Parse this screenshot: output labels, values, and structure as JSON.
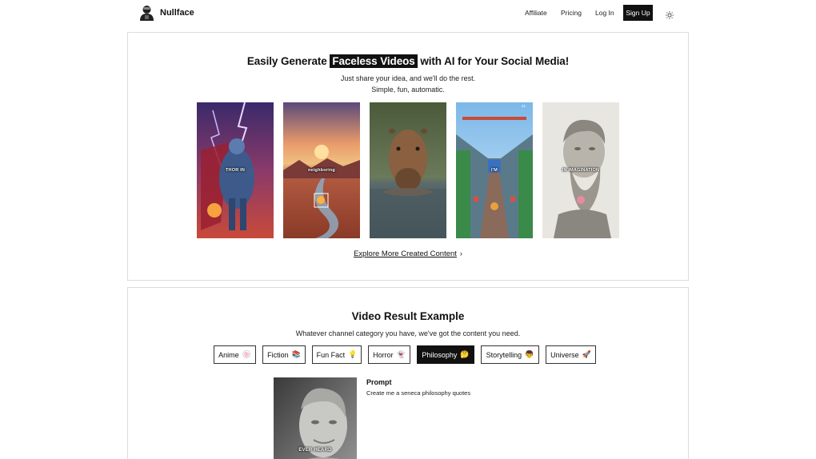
{
  "nav": {
    "brand": "Nullface",
    "links": [
      "Affiliate",
      "Pricing",
      "Log In"
    ],
    "signup": "Sign Up",
    "theme_icon": "sun-icon"
  },
  "hero": {
    "title_before": "Easily Generate",
    "title_highlight": "Faceless Videos",
    "title_after": "with AI for Your Social Media!",
    "subtitle_line1": "Just share your idea, and we'll do the rest.",
    "subtitle_line2": "Simple, fun, automatic.",
    "thumbnails": [
      {
        "caption": "THOR IN",
        "subject": "armored-hero-lightning"
      },
      {
        "caption": "neighboring",
        "subject": "red-desert-sunset"
      },
      {
        "caption": "",
        "subject": "capybara-in-water"
      },
      {
        "caption": "I'M",
        "subject": "subway-runner-game"
      },
      {
        "caption": "IN IMAGINATION",
        "subject": "stone-philosopher-bust"
      }
    ],
    "explore_label": "Explore More Created Content"
  },
  "examples": {
    "title": "Video Result Example",
    "subtitle": "Whatever channel category you have, we've got the content you need.",
    "categories": [
      {
        "label": "Anime",
        "emoji": "🍥"
      },
      {
        "label": "Fiction",
        "emoji": "📚"
      },
      {
        "label": "Fun Fact",
        "emoji": "💡"
      },
      {
        "label": "Horror",
        "emoji": "👻"
      },
      {
        "label": "Philosophy",
        "emoji": "🤔"
      },
      {
        "label": "Storytelling",
        "emoji": "👦"
      },
      {
        "label": "Universe",
        "emoji": "🚀"
      }
    ],
    "active_category": "Philosophy",
    "example_caption": "EVER HEARD",
    "prompt_label": "Prompt",
    "prompt_text": "Create me a seneca philosophy quotes"
  }
}
